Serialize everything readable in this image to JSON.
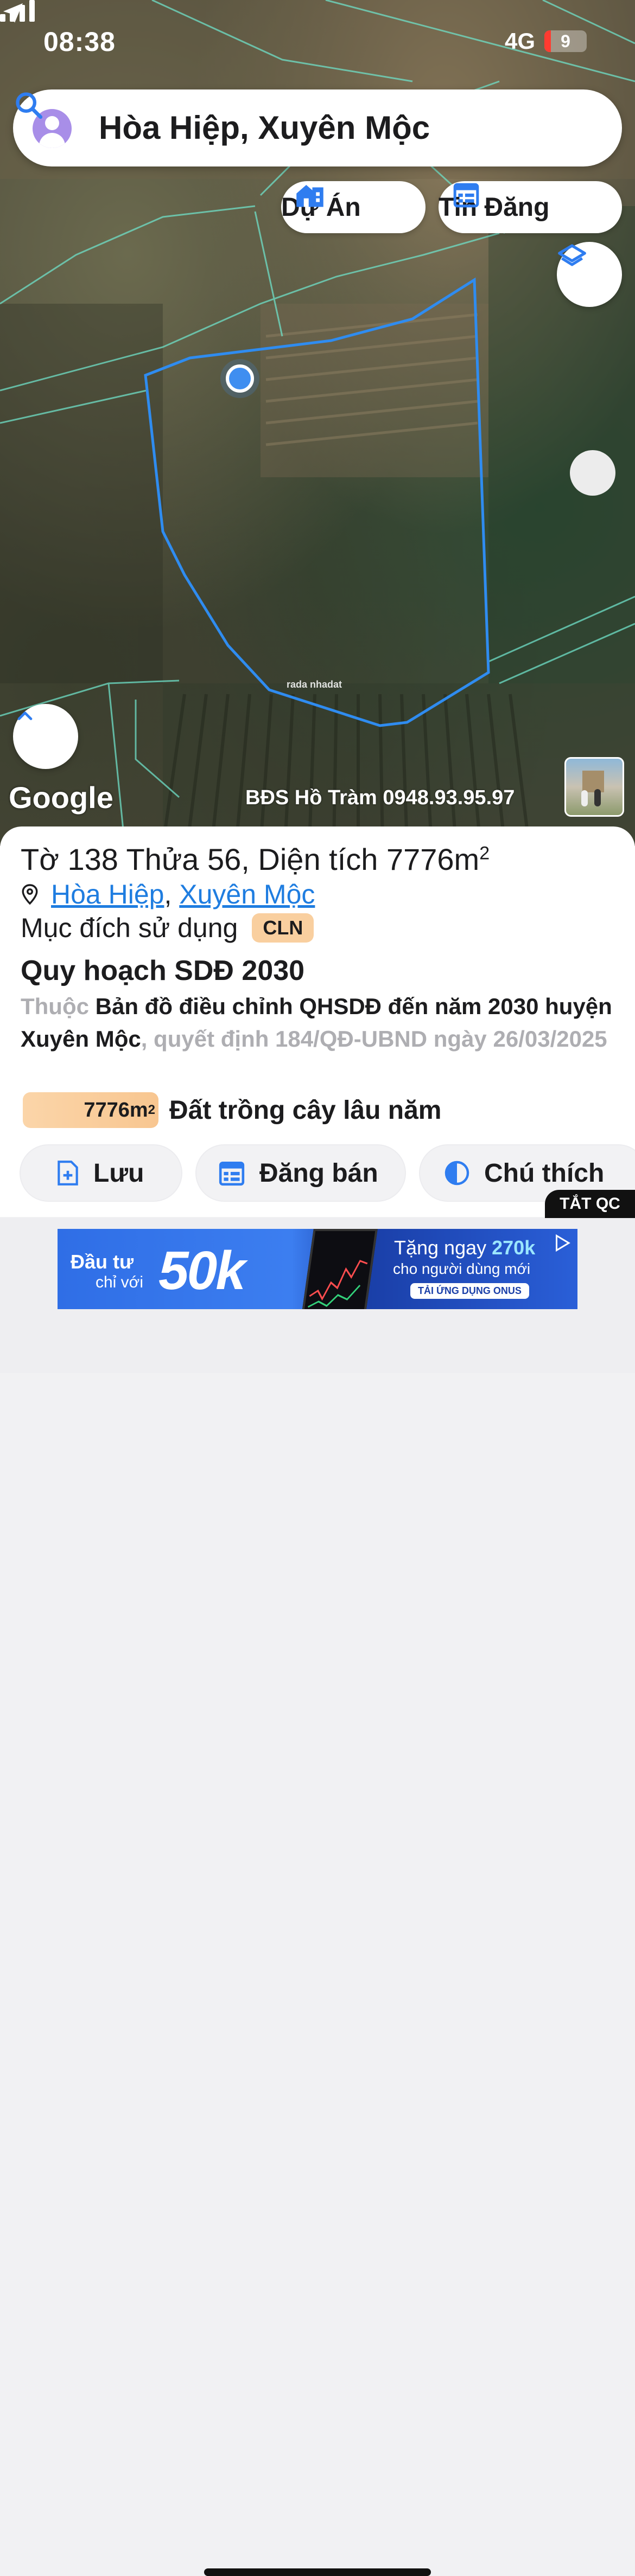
{
  "status_bar": {
    "time": "08:38",
    "network": "4G",
    "battery_level": "9"
  },
  "search": {
    "query": "Hòa Hiệp, Xuyên Mộc"
  },
  "chips": {
    "du_an": "Dự Án",
    "tin_dang": "Tin Đăng"
  },
  "map": {
    "google_logo": "Google",
    "watermark": "BĐS Hồ Tràm 0948.93.95.97",
    "brand_mark": "rada nhadat",
    "parcel_color": "#2f8cf0",
    "boundary_color": "#6fe0c8"
  },
  "parcel": {
    "title": "Tờ 138 Thửa 56, Diện tích 7776m",
    "title_sup": "2",
    "ward": "Hòa Hiệp",
    "separator": ",",
    "district": "Xuyên Mộc",
    "usage_label": "Mục đích sử dụng",
    "usage_code": "CLN",
    "plan_title": "Quy hoạch SDĐ 2030",
    "plan_prefix": "Thuộc",
    "plan_map": "Bản đồ điều chỉnh QHSDĐ đến năm 2030 huyện Xuyên Mộc",
    "plan_decision": ", quyết định 184/QĐ-UBND ngày 26/03/2025",
    "area_value": "7776m",
    "area_sup": "2",
    "area_type": "Đất trồng cây lâu năm"
  },
  "actions": {
    "save": "Lưu",
    "post_sale": "Đăng bán",
    "legend": "Chú thích",
    "hide_ads": "TẮT QC"
  },
  "ad": {
    "left_line1": "Đầu tư",
    "left_line2": "chỉ với",
    "big_amount": "50k",
    "right_prefix": "Tặng ngay",
    "right_amount": "270k",
    "right_line2": "cho người dùng mới",
    "cta": "TẢI ỨNG DỤNG ONUS"
  },
  "colors": {
    "accent_blue": "#1f7de0",
    "badge_orange": "#f9cf9f"
  }
}
